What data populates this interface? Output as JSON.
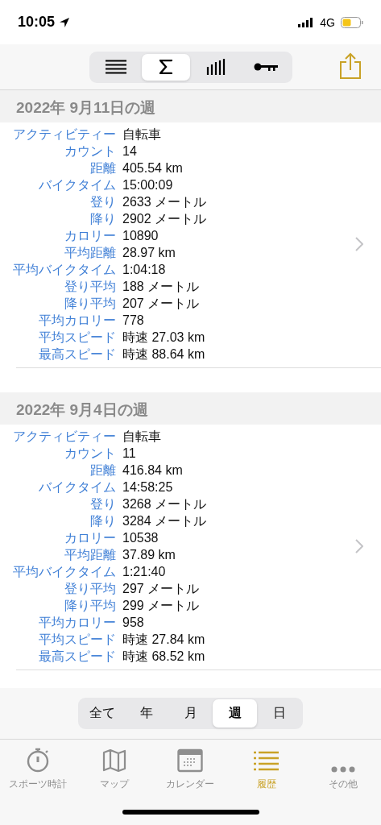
{
  "status_bar": {
    "time": "10:05",
    "network": "4G"
  },
  "toolbar": {
    "segments": [
      {
        "kind": "list",
        "selected": false
      },
      {
        "kind": "sum",
        "selected": true
      },
      {
        "kind": "bars",
        "selected": false
      },
      {
        "kind": "key",
        "selected": false
      }
    ]
  },
  "sections": [
    {
      "header": "2022年 9月11日の週",
      "rows": [
        {
          "label": "アクティビティー",
          "value": "自転車"
        },
        {
          "label": "カウント",
          "value": "14"
        },
        {
          "label": "距離",
          "value": "405.54 km"
        },
        {
          "label": "バイクタイム",
          "value": "15:00:09"
        },
        {
          "label": "登り",
          "value": "2633 メートル"
        },
        {
          "label": "降り",
          "value": "2902 メートル"
        },
        {
          "label": "カロリー",
          "value": "10890"
        },
        {
          "label": "平均距離",
          "value": "28.97 km"
        },
        {
          "label": "平均バイクタイム",
          "value": "1:04:18"
        },
        {
          "label": "登り平均",
          "value": "188 メートル"
        },
        {
          "label": "降り平均",
          "value": "207 メートル"
        },
        {
          "label": "平均カロリー",
          "value": "778"
        },
        {
          "label": "平均スピード",
          "value": "時速 27.03 km"
        },
        {
          "label": "最高スピード",
          "value": "時速 88.64 km"
        }
      ]
    },
    {
      "header": "2022年 9月4日の週",
      "rows": [
        {
          "label": "アクティビティー",
          "value": "自転車"
        },
        {
          "label": "カウント",
          "value": "11"
        },
        {
          "label": "距離",
          "value": "416.84 km"
        },
        {
          "label": "バイクタイム",
          "value": "14:58:25"
        },
        {
          "label": "登り",
          "value": "3268 メートル"
        },
        {
          "label": "降り",
          "value": "3284 メートル"
        },
        {
          "label": "カロリー",
          "value": "10538"
        },
        {
          "label": "平均距離",
          "value": "37.89 km"
        },
        {
          "label": "平均バイクタイム",
          "value": "1:21:40"
        },
        {
          "label": "登り平均",
          "value": "297 メートル"
        },
        {
          "label": "降り平均",
          "value": "299 メートル"
        },
        {
          "label": "平均カロリー",
          "value": "958"
        },
        {
          "label": "平均スピード",
          "value": "時速 27.84 km"
        },
        {
          "label": "最高スピード",
          "value": "時速 68.52 km"
        }
      ]
    }
  ],
  "period": [
    {
      "label": "全て",
      "selected": false
    },
    {
      "label": "年",
      "selected": false
    },
    {
      "label": "月",
      "selected": false
    },
    {
      "label": "週",
      "selected": true
    },
    {
      "label": "日",
      "selected": false
    }
  ],
  "tabs": [
    {
      "kind": "stopwatch",
      "label": "スポーツ時計",
      "selected": false
    },
    {
      "kind": "map",
      "label": "マップ",
      "selected": false
    },
    {
      "kind": "calendar",
      "label": "カレンダー",
      "selected": false
    },
    {
      "kind": "list",
      "label": "履歴",
      "selected": true
    },
    {
      "kind": "more",
      "label": "その他",
      "selected": false
    }
  ]
}
